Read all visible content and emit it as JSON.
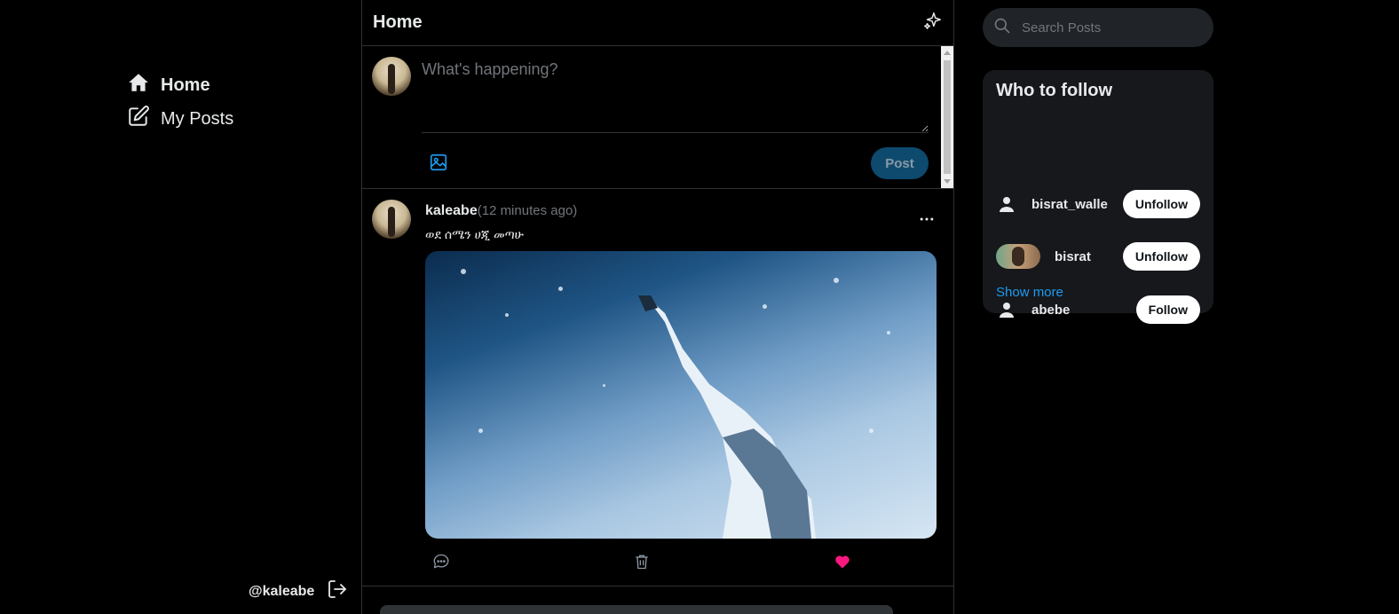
{
  "nav": {
    "home_label": "Home",
    "my_posts_label": "My Posts",
    "account_handle": "@kaleabe"
  },
  "header": {
    "title": "Home"
  },
  "composer": {
    "placeholder": "What's happening?",
    "post_label": "Post"
  },
  "post": {
    "username": "kaleabe",
    "time": "(12 minutes ago)",
    "text": "ወደ ሰሜን ሀጂ መጣሁ",
    "liked": true
  },
  "search": {
    "placeholder": "Search Posts"
  },
  "who_to_follow": {
    "title": "Who to follow",
    "users": [
      {
        "name": "bisrat_walle",
        "button": "Unfollow"
      },
      {
        "name": "bisrat",
        "button": "Unfollow"
      },
      {
        "name": "abebe",
        "button": "Follow"
      }
    ],
    "show_more": "Show more"
  },
  "colors": {
    "accent": "#1d9bf0",
    "like": "#f91880",
    "post_button": "#0e4a6e"
  }
}
